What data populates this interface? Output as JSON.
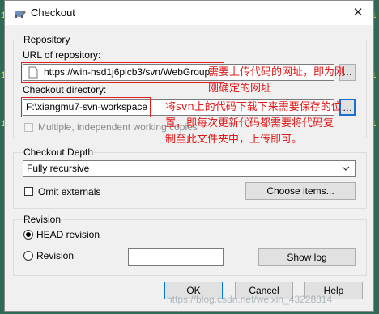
{
  "window": {
    "title": "Checkout",
    "close_glyph": "✕",
    "icon": "tortoisesvn-icon"
  },
  "repository": {
    "group_label": "Repository",
    "url_label": "URL of repository:",
    "url_value": "https://win-hsd1j6picb3/svn/WebGroup",
    "browse_glyph": "…",
    "checkout_dir_label": "Checkout directory:",
    "checkout_dir_value": "F:\\xiangmu7-svn-workspace",
    "multiple_label": "Multiple, independent working copies"
  },
  "depth": {
    "group_label": "Checkout Depth",
    "selected": "Fully recursive",
    "omit_externals": "Omit externals",
    "choose_items": "Choose items..."
  },
  "revision": {
    "group_label": "Revision",
    "head": "HEAD revision",
    "revision": "Revision",
    "show_log": "Show log"
  },
  "buttons": {
    "ok": "OK",
    "cancel": "Cancel",
    "help": "Help"
  },
  "annotations": {
    "url_note_line1": "需要上传代码的网址，即为刚",
    "url_note_line2": "刚确定的网址",
    "dir_note_line1": "将svn上的代码下载下来需要保存的位",
    "dir_note_line2": "置，即每次更新代码都需要将代码复",
    "dir_note_line3": "制至此文件夹中，上传即可。"
  },
  "watermark": "https://blog.csdn.net/weixin_43228814",
  "colors": {
    "annotation_red": "#e01818",
    "desktop": "#2d6b57"
  }
}
